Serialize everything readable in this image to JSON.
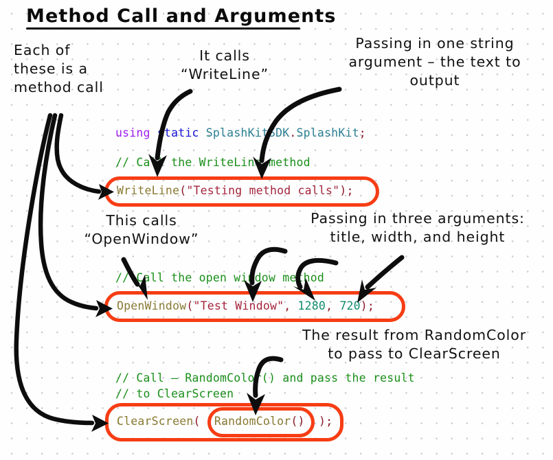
{
  "title": "Method Call and Arguments",
  "annotations": [
    {
      "id": "each-of-these",
      "text": "Each of\nthese is a\nmethod call"
    },
    {
      "id": "it-calls-writeline",
      "text": "It calls\n“WriteLine”"
    },
    {
      "id": "passing-one-string-arg",
      "text": "Passing in one string\nargument – the text to\noutput"
    },
    {
      "id": "this-calls-openwindow",
      "text": "This calls\n“OpenWindow”"
    },
    {
      "id": "passing-three-args",
      "text": "Passing in three arguments:\ntitle, width, and height"
    },
    {
      "id": "result-from-randomcolor",
      "text": "The result from RandomColor\nto pass to ClearScreen"
    }
  ],
  "code": {
    "using_line": {
      "keyword": "using",
      "modifier": "static",
      "namespace": "SplashKitSDK",
      "dot": ".",
      "class": "SplashKit",
      "semicolon": ";"
    },
    "comment_writeline": "// Call the WriteLine method",
    "writeline_stmt": {
      "method": "WriteLine",
      "open_paren": "(",
      "argument": "\"Testing method calls\"",
      "close_paren": ")",
      "semicolon": ";"
    },
    "comment_openwindow": "// Call the open window method",
    "openwindow_stmt": {
      "method": "OpenWindow",
      "open_paren": "(",
      "arg_title": "\"Test Window\"",
      "comma1": ", ",
      "arg_width": "1280",
      "comma2": ", ",
      "arg_height": "720",
      "close_paren": ")",
      "semicolon": ";"
    },
    "comment_clearscreen_1": "// Call – RandomColor() and pass the result",
    "comment_clearscreen_2": "// to ClearScreen",
    "clearscreen_stmt": {
      "method": "ClearScreen",
      "open_paren": "(",
      "inner_method": "RandomColor",
      "inner_parens": "()",
      "close_paren": ")",
      "semicolon": ";"
    }
  },
  "colors": {
    "highlight": "#f63d14",
    "keyword": "#a020f0",
    "modifier": "#1414d4",
    "type": "#2a7f91",
    "comment": "#1a8f1a",
    "method": "#8a7a32",
    "string": "#a3253c",
    "number": "#128c6e",
    "punctuation": "#8b1a2b",
    "ink": "#111111",
    "background": "#fefefe",
    "grid_dot": "#c9c9d2"
  }
}
